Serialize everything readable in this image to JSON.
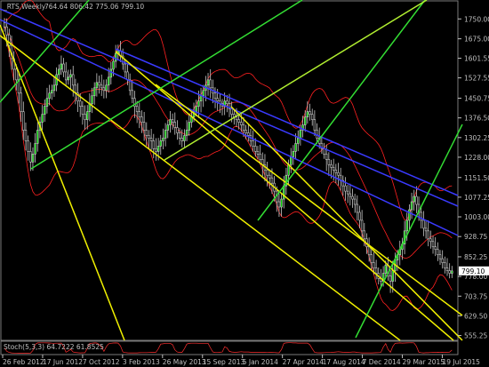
{
  "header": {
    "symbol_label": "_RTS,Weekly",
    "ohlc_label": "764.64 806.42 775.06 799.10"
  },
  "indicator": {
    "label": "Stoch(5,3,3) 64.7222 61.8525"
  },
  "colors": {
    "background": "#000000",
    "axis": "#c0c0c0",
    "bull": "#00d000",
    "bear": "#000000",
    "wick": "#c8c8c8",
    "bollinger": "#ff2020",
    "trend_blue": "#3a3aff",
    "trend_yellow": "#f0f000",
    "trend_green": "#33dd33",
    "trend_lime": "#b0ee30",
    "last_price_bg": "#ffffff",
    "last_price_fg": "#000000",
    "stoch": "#ff3030"
  },
  "chart_data": {
    "type": "candlestick",
    "title": "_RTS,Weekly",
    "ylim": [
      547,
      1808
    ],
    "y_ticks": [
      "1750.00",
      "1675.00",
      "1601.55",
      "1527.55",
      "1450.75",
      "1376.50",
      "1302.25",
      "1228.00",
      "1151.50",
      "1077.25",
      "1003.00",
      "928.75",
      "852.25",
      "778.00",
      "703.75",
      "629.50",
      "555.25"
    ],
    "x_ticks": [
      "26 Feb 2012",
      "17 Jun 2012",
      "7 Oct 2012",
      "3 Feb 2013",
      "26 May 2013",
      "15 Sep 2013",
      "5 Jan 2014",
      "27 Apr 2014",
      "17 Aug 2014",
      "7 Dec 2014",
      "29 Mar 2015",
      "19 Jul 2015"
    ],
    "last_price": "799.10",
    "closes": [
      1720,
      1690,
      1650,
      1600,
      1560,
      1520,
      1470,
      1400,
      1330,
      1290,
      1250,
      1210,
      1240,
      1280,
      1330,
      1360,
      1390,
      1420,
      1450,
      1470,
      1480,
      1500,
      1540,
      1560,
      1580,
      1550,
      1520,
      1530,
      1540,
      1500,
      1470,
      1440,
      1420,
      1390,
      1370,
      1400,
      1430,
      1460,
      1490,
      1510,
      1500,
      1490,
      1480,
      1500,
      1530,
      1560,
      1590,
      1620,
      1630,
      1610,
      1580,
      1550,
      1520,
      1480,
      1450,
      1420,
      1400,
      1380,
      1360,
      1330,
      1310,
      1300,
      1290,
      1260,
      1250,
      1270,
      1290,
      1300,
      1330,
      1350,
      1370,
      1360,
      1340,
      1320,
      1300,
      1290,
      1310,
      1330,
      1360,
      1380,
      1400,
      1420,
      1440,
      1460,
      1480,
      1500,
      1520,
      1490,
      1470,
      1450,
      1440,
      1430,
      1420,
      1440,
      1430,
      1410,
      1390,
      1380,
      1370,
      1360,
      1350,
      1330,
      1320,
      1310,
      1290,
      1270,
      1250,
      1240,
      1220,
      1200,
      1180,
      1160,
      1150,
      1130,
      1100,
      1060,
      1040,
      1070,
      1120,
      1160,
      1200,
      1230,
      1250,
      1280,
      1300,
      1330,
      1350,
      1380,
      1400,
      1390,
      1370,
      1330,
      1300,
      1280,
      1260,
      1240,
      1220,
      1200,
      1190,
      1180,
      1170,
      1160,
      1140,
      1120,
      1100,
      1090,
      1080,
      1070,
      1050,
      1020,
      990,
      950,
      920,
      890,
      860,
      830,
      810,
      790,
      770,
      760,
      790,
      820,
      780,
      760,
      800,
      840,
      860,
      880,
      900,
      950,
      990,
      1030,
      1060,
      1080,
      1050,
      1020,
      990,
      960,
      950,
      920,
      910,
      890,
      880,
      860,
      845,
      830,
      810,
      800,
      790,
      799
    ]
  }
}
